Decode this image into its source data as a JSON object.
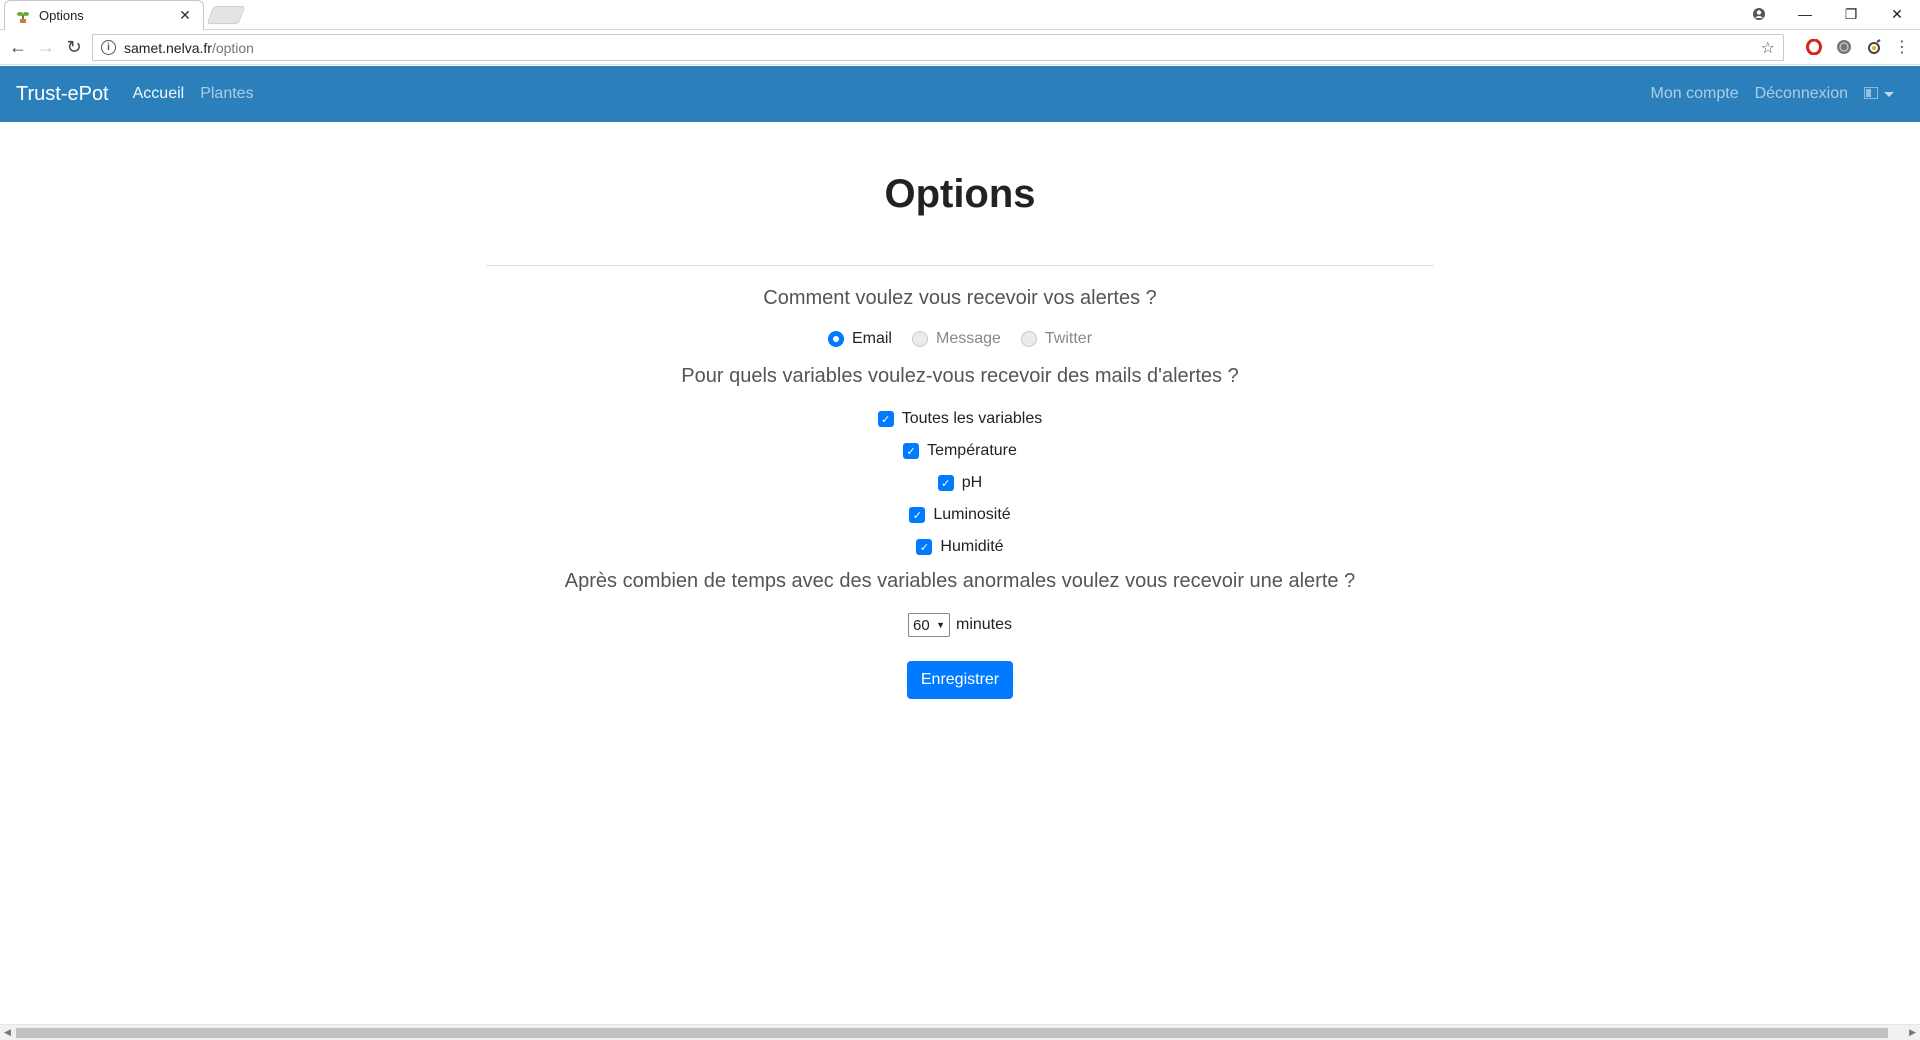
{
  "browser": {
    "tab_title": "Options",
    "url_host": "samet.nelva.fr",
    "url_path": "/option"
  },
  "navbar": {
    "brand": "Trust-ePot",
    "links": [
      "Accueil",
      "Plantes"
    ],
    "right_links": [
      "Mon compte",
      "Déconnexion"
    ]
  },
  "page": {
    "title": "Options",
    "question_alert": "Comment voulez vous recevoir vos alertes ?",
    "radio_options": [
      {
        "label": "Email",
        "checked": true
      },
      {
        "label": "Message",
        "checked": false
      },
      {
        "label": "Twitter",
        "checked": false
      }
    ],
    "question_variables": "Pour quels variables voulez-vous recevoir des mails d'alertes ?",
    "checkboxes": [
      {
        "label": "Toutes les variables",
        "checked": true
      },
      {
        "label": "Température",
        "checked": true
      },
      {
        "label": "pH",
        "checked": true
      },
      {
        "label": "Luminosité",
        "checked": true
      },
      {
        "label": "Humidité",
        "checked": true
      }
    ],
    "question_delay": "Après combien de temps avec des variables anormales voulez vous recevoir une alerte ?",
    "delay_value": "60",
    "delay_unit": "minutes",
    "save_button": "Enregistrer"
  },
  "colors": {
    "navbar": "#2b80bb",
    "primary": "#007bff"
  }
}
